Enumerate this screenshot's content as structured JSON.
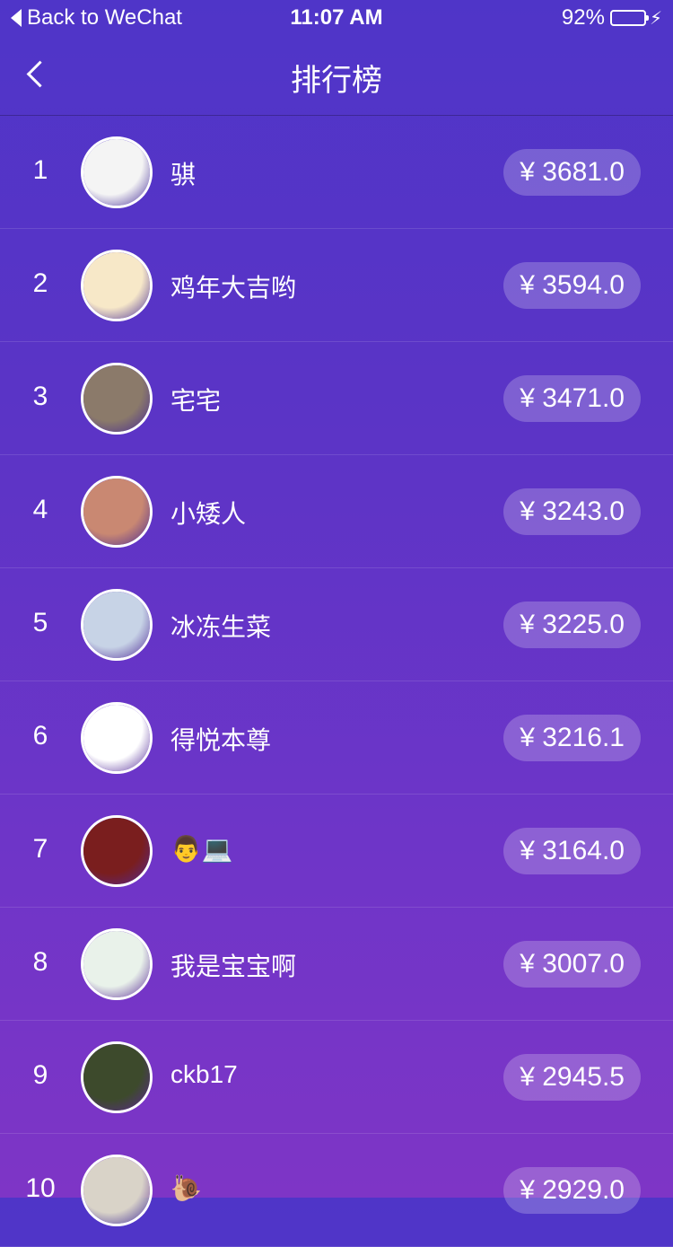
{
  "status_bar": {
    "back_label": "Back to WeChat",
    "time": "11:07 AM",
    "battery": "92%",
    "battery_level": 0.92
  },
  "nav": {
    "title": "排行榜",
    "back_icon": "chevron-left-icon"
  },
  "ranking": [
    {
      "rank": "1",
      "name": "骐",
      "amount": "¥ 3681.0",
      "avatar_color": "#f4f4f4"
    },
    {
      "rank": "2",
      "name": "鸡年大吉哟",
      "amount": "¥ 3594.0",
      "avatar_color": "#f7e8c8"
    },
    {
      "rank": "3",
      "name": "宅宅",
      "amount": "¥ 3471.0",
      "avatar_color": "#8b7a6a"
    },
    {
      "rank": "4",
      "name": "小矮人",
      "amount": "¥ 3243.0",
      "avatar_color": "#c98872"
    },
    {
      "rank": "5",
      "name": "冰冻生菜",
      "amount": "¥ 3225.0",
      "avatar_color": "#c7d3e6"
    },
    {
      "rank": "6",
      "name": "得悦本尊",
      "amount": "¥ 3216.1",
      "avatar_color": "#ffffff"
    },
    {
      "rank": "7",
      "name": "👨💻",
      "amount": "¥ 3164.0",
      "avatar_color": "#7a1e1e"
    },
    {
      "rank": "8",
      "name": "我是宝宝啊",
      "amount": "¥ 3007.0",
      "avatar_color": "#e9f2ea"
    },
    {
      "rank": "9",
      "name": "ckb17",
      "amount": "¥ 2945.5",
      "avatar_color": "#3d4a2c"
    },
    {
      "rank": "10",
      "name": "🐌",
      "amount": "¥ 2929.0",
      "avatar_color": "#d9d3c8"
    }
  ]
}
